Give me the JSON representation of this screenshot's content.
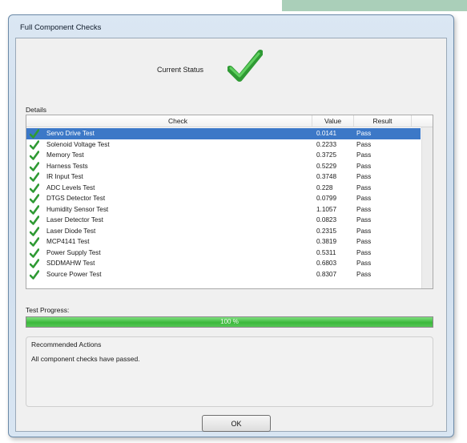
{
  "window": {
    "title": "Full Component Checks"
  },
  "status": {
    "label": "Current Status",
    "icon": "check-icon"
  },
  "details": {
    "label": "Details",
    "columns": [
      "Check",
      "Value",
      "Result"
    ],
    "rows": [
      {
        "check": "Servo Drive Test",
        "value": "0.0141",
        "result": "Pass",
        "selected": true
      },
      {
        "check": "Solenoid Voltage Test",
        "value": "0.2233",
        "result": "Pass"
      },
      {
        "check": "Memory Test",
        "value": "0.3725",
        "result": "Pass"
      },
      {
        "check": "Harness Tests",
        "value": "0.5229",
        "result": "Pass"
      },
      {
        "check": "IR Input Test",
        "value": "0.3748",
        "result": "Pass"
      },
      {
        "check": "ADC Levels Test",
        "value": "0.228",
        "result": "Pass"
      },
      {
        "check": "DTGS Detector Test",
        "value": "0.0799",
        "result": "Pass"
      },
      {
        "check": "Humidity Sensor Test",
        "value": "1.1057",
        "result": "Pass"
      },
      {
        "check": "Laser Detector Test",
        "value": "0.0823",
        "result": "Pass"
      },
      {
        "check": "Laser Diode Test",
        "value": "0.2315",
        "result": "Pass"
      },
      {
        "check": "MCP4141 Test",
        "value": "0.3819",
        "result": "Pass"
      },
      {
        "check": "Power Supply Test",
        "value": "0.5311",
        "result": "Pass"
      },
      {
        "check": "SDDMAHW Test",
        "value": "0.6803",
        "result": "Pass"
      },
      {
        "check": "Source Power Test",
        "value": "0.8307",
        "result": "Pass"
      }
    ]
  },
  "progress": {
    "label": "Test Progress:",
    "percent": 100,
    "text": "100 %"
  },
  "recommended": {
    "title": "Recommended Actions",
    "text": "All component checks have passed."
  },
  "buttons": {
    "ok": "OK"
  },
  "colors": {
    "accent_green": "#3cb83c",
    "selection": "#3c78c7"
  }
}
